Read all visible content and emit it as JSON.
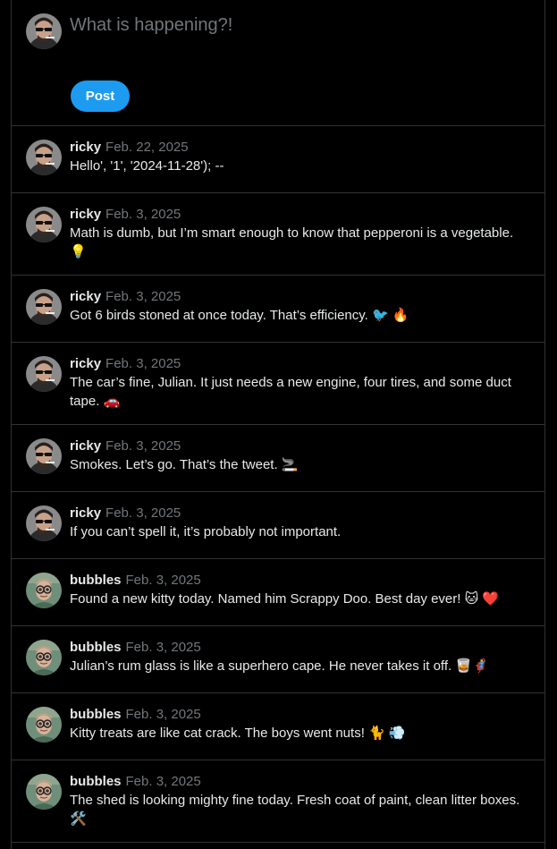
{
  "composer": {
    "placeholder": "What is happening?!",
    "post_label": "Post"
  },
  "colors": {
    "accent": "#1d9bf0",
    "background": "#000000",
    "text": "#e7e9ea",
    "muted": "#71767b",
    "border": "#2f3336"
  },
  "tweets": [
    {
      "author": "ricky",
      "date": "Feb. 22, 2025",
      "text": "Hello', '1', '2024-11-28'); --"
    },
    {
      "author": "ricky",
      "date": "Feb. 3, 2025",
      "text": "Math is dumb, but I’m smart enough to know that pepperoni is a vegetable. 💡"
    },
    {
      "author": "ricky",
      "date": "Feb. 3, 2025",
      "text": "Got 6 birds stoned at once today. That’s efficiency. 🐦 🔥"
    },
    {
      "author": "ricky",
      "date": "Feb. 3, 2025",
      "text": "The car’s fine, Julian. It just needs a new engine, four tires, and some duct tape. 🚗"
    },
    {
      "author": "ricky",
      "date": "Feb. 3, 2025",
      "text": "Smokes. Let’s go. That’s the tweet. 🚬"
    },
    {
      "author": "ricky",
      "date": "Feb. 3, 2025",
      "text": "If you can’t spell it, it’s probably not important."
    },
    {
      "author": "bubbles",
      "date": "Feb. 3, 2025",
      "text": "Found a new kitty today. Named him Scrappy Doo. Best day ever! 🐱 ❤️"
    },
    {
      "author": "bubbles",
      "date": "Feb. 3, 2025",
      "text": "Julian’s rum glass is like a superhero cape. He never takes it off. 🥃🦸"
    },
    {
      "author": "bubbles",
      "date": "Feb. 3, 2025",
      "text": "Kitty treats are like cat crack. The boys went nuts! 🐈 💨"
    },
    {
      "author": "bubbles",
      "date": "Feb. 3, 2025",
      "text": "The shed is looking mighty fine today. Fresh coat of paint, clean litter boxes. 🛠️"
    }
  ]
}
